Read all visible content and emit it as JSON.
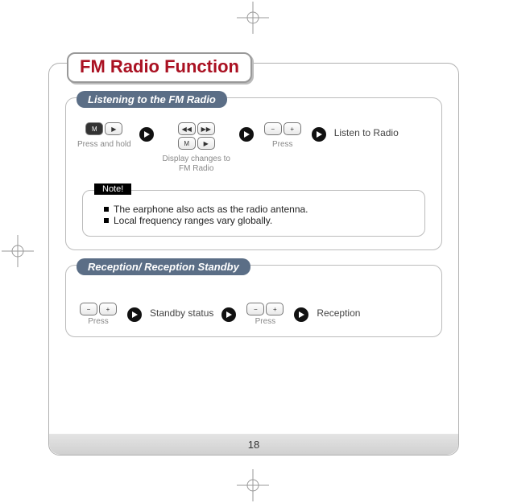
{
  "page": {
    "title": "FM Radio Function",
    "number": "18"
  },
  "section_listen": {
    "header": "Listening to the FM Radio",
    "step1_caption": "Press and hold",
    "step2_caption": "Display changes to FM Radio",
    "step3_caption": "Press",
    "result": "Listen to Radio"
  },
  "note": {
    "tag": "Note!",
    "line1": "The earphone also acts as the radio antenna.",
    "line2": "Local frequency ranges vary globally."
  },
  "section_recep": {
    "header": "Reception/ Reception Standby",
    "step1_caption": "Press",
    "state1": "Standby status",
    "step2_caption": "Press",
    "state2": "Reception"
  },
  "icons": {
    "m": "M",
    "play": "▶",
    "rew": "◀◀",
    "fwd": "▶▶",
    "minus": "−",
    "plus": "+"
  }
}
